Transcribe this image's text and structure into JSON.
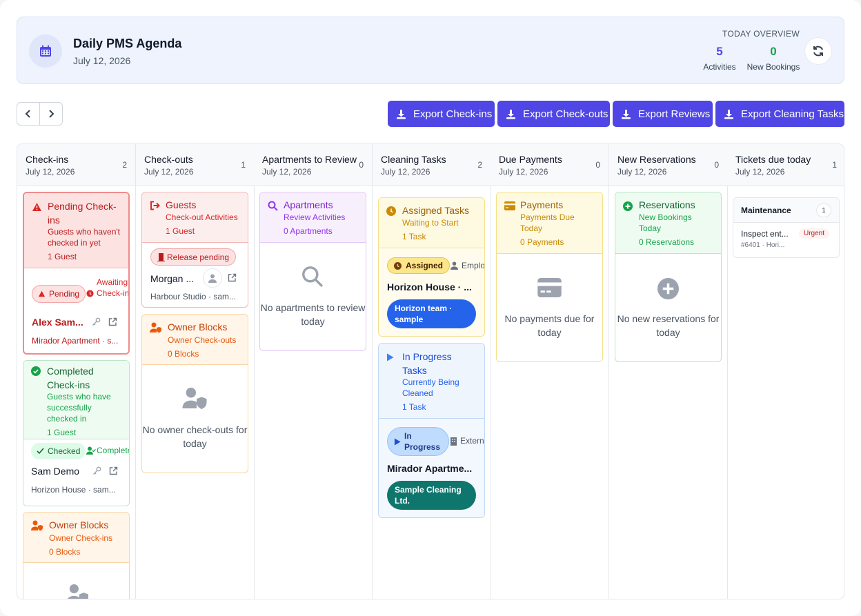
{
  "header": {
    "title": "Daily PMS Agenda",
    "date": "July 12, 2026",
    "overview_label": "TODAY OVERVIEW",
    "activities_count": "5",
    "activities_label": "Activities",
    "bookings_count": "0",
    "bookings_label": "New Bookings"
  },
  "exports": [
    "Export Check-ins",
    "Export Check-outs",
    "Export Reviews",
    "Export Cleaning Tasks"
  ],
  "columns": [
    {
      "title": "Check-ins",
      "date": "July 12, 2026",
      "count": "2"
    },
    {
      "title": "Check-outs",
      "date": "July 12, 2026",
      "count": "1"
    },
    {
      "title": "Apartments to Review",
      "date": "July 12, 2026",
      "count": "0"
    },
    {
      "title": "Cleaning Tasks",
      "date": "July 12, 2026",
      "count": "2"
    },
    {
      "title": "Due Payments",
      "date": "July 12, 2026",
      "count": "0"
    },
    {
      "title": "New Reservations",
      "date": "July 12, 2026",
      "count": "0"
    },
    {
      "title": "Tickets due today",
      "date": "July 12, 2026",
      "count": "1"
    }
  ],
  "checkins": {
    "pending": {
      "title": "Pending Check-ins",
      "subtitle": "Guests who haven't checked in yet",
      "count": "1 Guest",
      "badge": "Pending",
      "status": "Awaiting Check-in",
      "guest": "Alex Sam...",
      "place": "Mirador Apartment · s..."
    },
    "completed": {
      "title": "Completed Check-ins",
      "subtitle": "Guests who have successfully checked in",
      "count": "1 Guest",
      "badge": "Checked",
      "status": "Complete",
      "guest": "Sam Demo",
      "place": "Horizon House · sam..."
    },
    "owner": {
      "title": "Owner Blocks",
      "subtitle": "Owner Check-ins",
      "count": "0 Blocks"
    }
  },
  "checkouts": {
    "guests": {
      "title": "Guests",
      "subtitle": "Check-out Activities",
      "count": "1 Guest",
      "badge": "Release pending",
      "guest": "Morgan ...",
      "place": "Harbour Studio · sam..."
    },
    "owner": {
      "title": "Owner Blocks",
      "subtitle": "Owner Check-outs",
      "count": "0 Blocks",
      "empty": "No owner check-outs for today"
    }
  },
  "reviews": {
    "title": "Apartments",
    "subtitle": "Review Activities",
    "count": "0 Apartments",
    "empty": "No apartments to review today"
  },
  "cleaning": {
    "assigned": {
      "title": "Assigned Tasks",
      "subtitle": "Waiting to Start",
      "count": "1 Task",
      "badge": "Assigned",
      "assignee": "Emplo",
      "place": "Horizon House · ...",
      "team": "Horizon team · sample"
    },
    "progress": {
      "title": "In Progress Tasks",
      "subtitle": "Currently Being Cleaned",
      "count": "1 Task",
      "badge": "In Progress",
      "assignee": "Extern",
      "place": "Mirador Apartme...",
      "team": "Sample Cleaning Ltd."
    }
  },
  "payments": {
    "title": "Payments",
    "subtitle": "Payments Due Today",
    "count": "0 Payments",
    "empty": "No payments due for today"
  },
  "reservations": {
    "title": "Reservations",
    "subtitle": "New Bookings Today",
    "count": "0 Reservations",
    "empty": "No new reservations for today"
  },
  "tickets": {
    "group": "Maintenance",
    "group_count": "1",
    "task": "Inspect ent...",
    "priority": "Urgent",
    "meta": "#6401 · Hori..."
  },
  "colors": {
    "accent": "#4f46e5",
    "red": "#dc2626",
    "green": "#16a34a",
    "orange": "#ea580c",
    "purple": "#9333ea",
    "yellow": "#ca8a04",
    "blue": "#2563eb"
  }
}
